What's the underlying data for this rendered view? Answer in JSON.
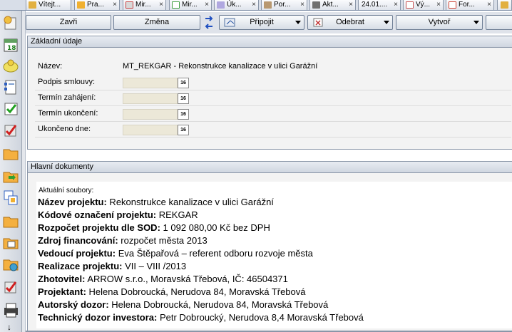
{
  "tabs": [
    {
      "label": "Vítejt...",
      "icon": "home-icon",
      "color": "#d8a020"
    },
    {
      "label": "Pra...",
      "icon": "folder-icon",
      "color": "#f0b030"
    },
    {
      "label": "Mir...",
      "icon": "edit-icon",
      "color": "#c84040"
    },
    {
      "label": "Mir...",
      "icon": "calendar-icon",
      "color": "#40a040"
    },
    {
      "label": "Úk...",
      "icon": "task-icon",
      "color": "#7060c0"
    },
    {
      "label": "Por...",
      "icon": "meeting-icon",
      "color": "#806040"
    },
    {
      "label": "Akt...",
      "icon": "tools-icon",
      "color": "#505050"
    },
    {
      "label": "24.01....",
      "icon": "",
      "color": ""
    },
    {
      "label": "Vý...",
      "icon": "report-icon",
      "color": "#c85050"
    },
    {
      "label": "For...",
      "icon": "form-icon",
      "color": "#d04030"
    }
  ],
  "tab_close_glyph": "×",
  "toolbar": {
    "close_label": "Zavři",
    "change_label": "Změna",
    "attach_label": "Připojit",
    "remove_label": "Odebrat",
    "create_label": "Vytvoř"
  },
  "basic_section": {
    "title": "Základní údaje",
    "name_label": "Název:",
    "name_value": "MT_REKGAR - Rekonstrukce kanalizace v ulici Garážní",
    "date_fields": [
      {
        "label": "Podpis smlouvy:",
        "value": ""
      },
      {
        "label": "Termín zahájení:",
        "value": ""
      },
      {
        "label": "Termín ukončení:",
        "value": ""
      },
      {
        "label": "Ukončeno dne:",
        "value": ""
      }
    ],
    "calendar_button_text": "16"
  },
  "documents_section": {
    "title": "Hlavní dokumenty",
    "caption": "Aktuální soubory:",
    "lines": [
      {
        "key": "Název projektu:",
        "value": " Rekonstrukce kanalizace v ulici Garážní"
      },
      {
        "key": "Kódové označení projektu:",
        "value": " REKGAR"
      },
      {
        "key": "Rozpočet projektu dle SOD:",
        "value": " 1 092 080,00  Kč bez DPH"
      },
      {
        "key": "Zdroj financování:",
        "value": " rozpočet města 2013"
      },
      {
        "key": "Vedoucí projektu:",
        "value": " Eva Štěpařová – referent odboru rozvoje města"
      },
      {
        "key": "Realizace projektu:",
        "value": " VII – VIII /2013"
      },
      {
        "key": "Zhotovitel:",
        "value": " ARROW s.r.o., Moravská Třebová, IČ: 46504371"
      },
      {
        "key": "Projektant:",
        "value": " Helena Dobroucká, Nerudova 84, Moravská Třebová"
      },
      {
        "key": "Autorský dozor:",
        "value": " Helena Dobroucká, Nerudova 84, Moravská Třebová"
      },
      {
        "key": "Technický dozor investora:",
        "value": " Petr Dobroucký, Nerudova 8,4 Moravská Třebová"
      }
    ]
  },
  "colors": {
    "toolbar_bg": "#dfe3ea",
    "section_header": "#d6dce6",
    "date_field_bg": "#ece8d8"
  }
}
